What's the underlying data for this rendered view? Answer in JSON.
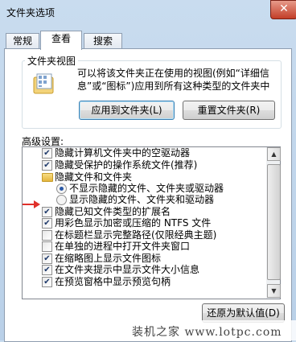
{
  "window": {
    "title": "文件夹选项",
    "close_glyph": "✕"
  },
  "tabs": [
    {
      "label": "常规"
    },
    {
      "label": "查看"
    },
    {
      "label": "搜索"
    }
  ],
  "folder_views": {
    "group_label": "文件夹视图",
    "description_line1": "可以将该文件夹正在使用的视图(例如“详细信",
    "description_line2": "息”或“图标”)应用到所有这种类型的文件夹中",
    "apply_button": "应用到文件夹(L)",
    "reset_button": "重置文件夹(R)"
  },
  "advanced": {
    "label": "高级设置:",
    "items": [
      {
        "label": "隐藏计算机文件夹中的空驱动器",
        "checked": "✔"
      },
      {
        "label": "隐藏受保护的操作系统文件(推荐)",
        "checked": "✔"
      },
      {
        "label": "隐藏文件和文件夹"
      },
      {
        "label": "不显示隐藏的文件、文件夹或驱动器",
        "selected": true
      },
      {
        "label": "显示隐藏的文件、文件夹和驱动器",
        "selected": false
      },
      {
        "label": "隐藏已知文件类型的扩展名",
        "checked": "✔"
      },
      {
        "label": "用彩色显示加密或压缩的 NTFS 文件",
        "checked": "✔"
      },
      {
        "label": "在标题栏显示完整路径(仅限经典主题)",
        "checked": ""
      },
      {
        "label": "在单独的进程中打开文件夹窗口",
        "checked": ""
      },
      {
        "label": "在缩略图上显示文件图标",
        "checked": "✔"
      },
      {
        "label": "在文件夹提示中显示文件大小信息",
        "checked": "✔"
      },
      {
        "label": "在预览窗格中显示预览句柄",
        "checked": "✔"
      }
    ]
  },
  "restore_button": "还原为默认值(D)",
  "watermark": "装机之家 www.lotpc.com",
  "annotation_arrow": "→",
  "colors": {
    "arrow": "#e0302a",
    "titlebar": "#c9dcef"
  }
}
